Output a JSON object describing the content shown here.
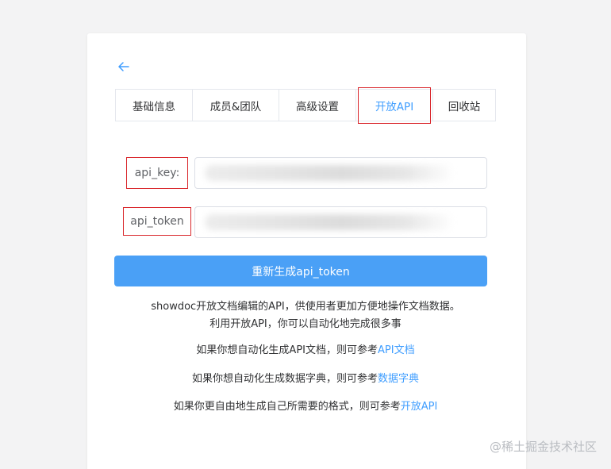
{
  "tabs": [
    {
      "label": "基础信息"
    },
    {
      "label": "成员&团队"
    },
    {
      "label": "高级设置"
    },
    {
      "label": "开放API"
    },
    {
      "label": "回收站"
    }
  ],
  "active_tab": "开放API",
  "form": {
    "api_key_label": "api_key:",
    "api_token_label": "api_token"
  },
  "regenerate_button": "重新生成api_token",
  "description": {
    "line1": "showdoc开放文档编辑的API，供使用者更加方便地操作文档数据。",
    "line2": "利用开放API，你可以自动化地完成很多事",
    "api_doc_text": "如果你想自动化生成API文档，则可参考",
    "api_doc_link": "API文档",
    "dict_text": "如果你想自动化生成数据字典，则可参考",
    "dict_link": "数据字典",
    "custom_text": "如果你更自由地生成自己所需要的格式，则可参考",
    "custom_link": "开放API"
  },
  "watermark": "@稀土掘金技术社区",
  "colors": {
    "accent": "#409eff",
    "button": "#4aa0f6",
    "highlight_box": "#d9262b"
  }
}
